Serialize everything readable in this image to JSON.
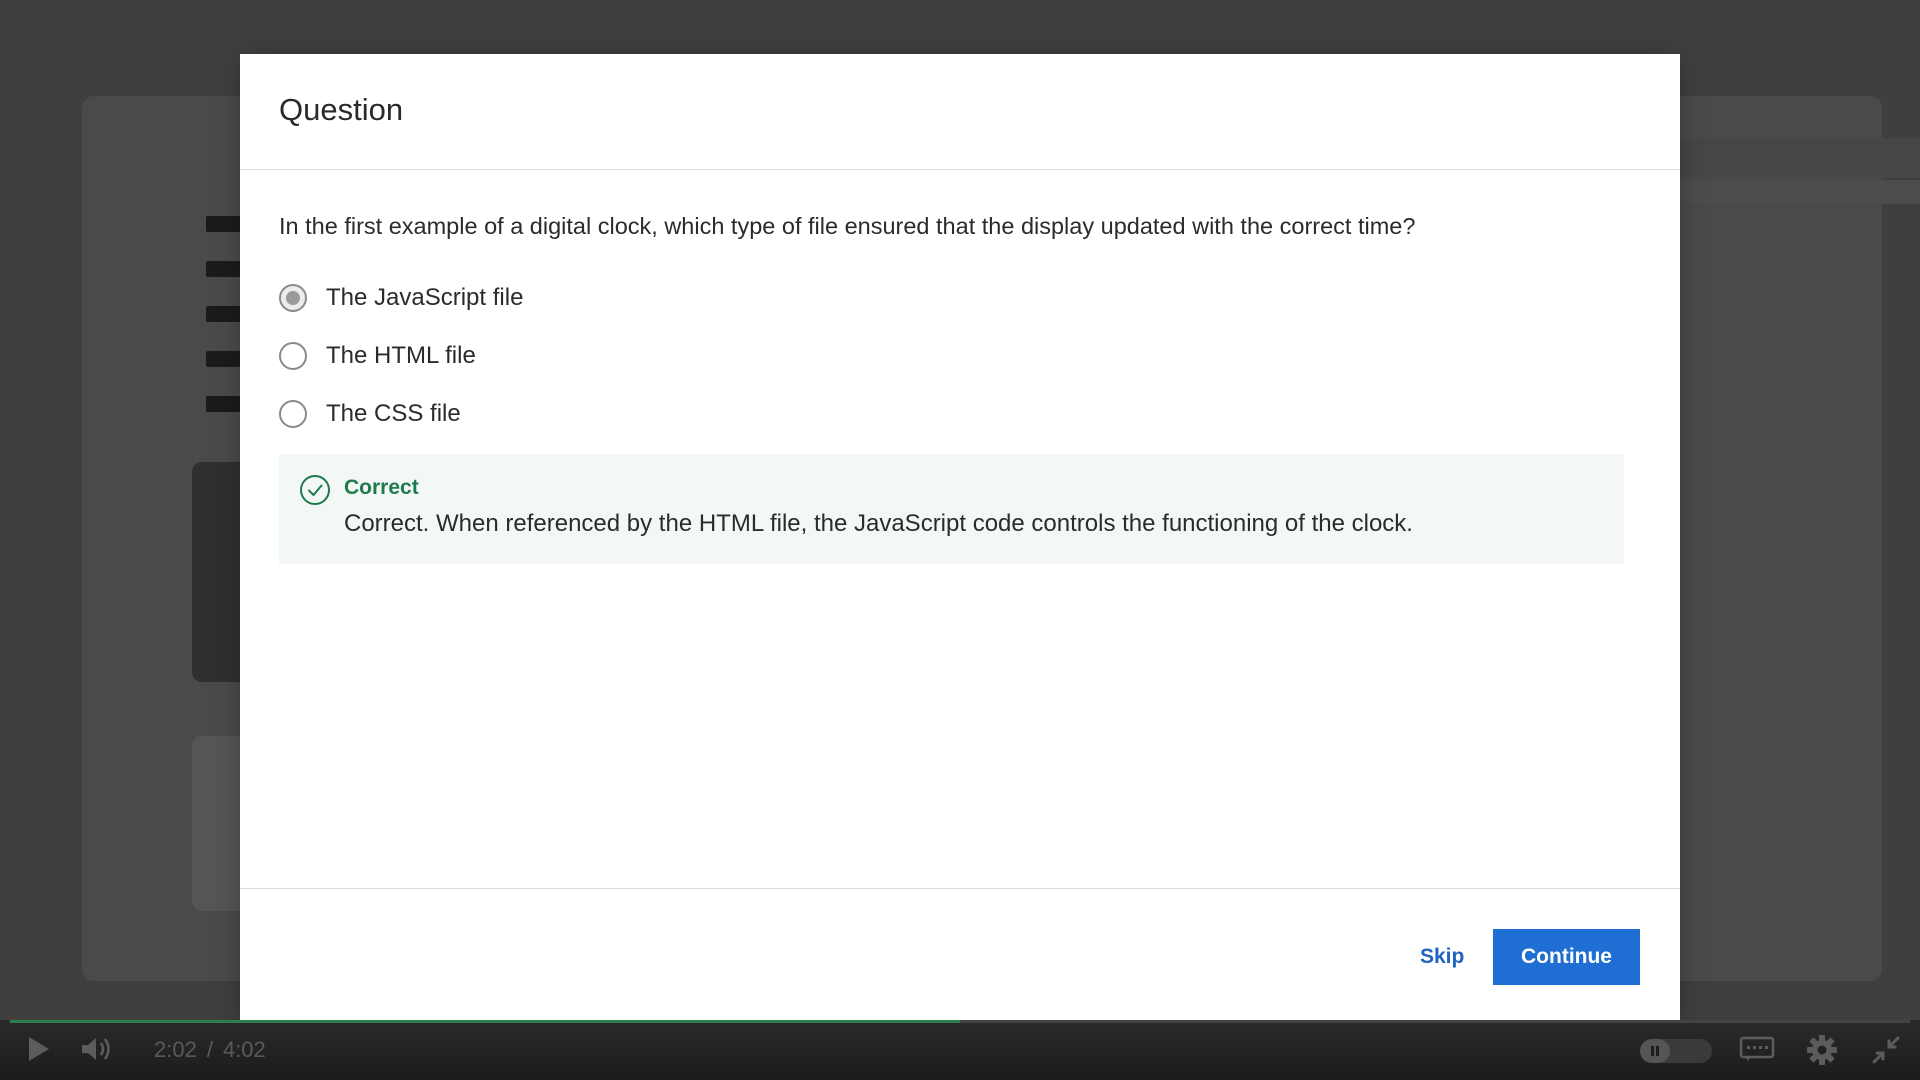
{
  "modal": {
    "title": "Question",
    "question": "In the first example of a digital clock, which type of file ensured that the display updated with the correct time?",
    "options": [
      {
        "label": "The JavaScript file",
        "selected": true
      },
      {
        "label": "The HTML file",
        "selected": false
      },
      {
        "label": "The CSS file",
        "selected": false
      }
    ],
    "feedback": {
      "title": "Correct",
      "message": "Correct. When referenced by the HTML file, the JavaScript code controls the functioning of the clock.",
      "icon": "check-circle-icon",
      "color": "#1f7a4d"
    },
    "footer": {
      "skip_label": "Skip",
      "continue_label": "Continue"
    }
  },
  "player": {
    "current_time": "2:02",
    "separator": "/",
    "duration": "4:02",
    "progress_fraction": 0.5,
    "icons": [
      "play-icon",
      "volume-icon",
      "captions-icon",
      "settings-icon",
      "exit-fullscreen-icon"
    ]
  },
  "colors": {
    "accent": "#1f6ed4",
    "link": "#1f64c4",
    "success": "#1f7a4d",
    "progress": "#2e7d4f"
  }
}
